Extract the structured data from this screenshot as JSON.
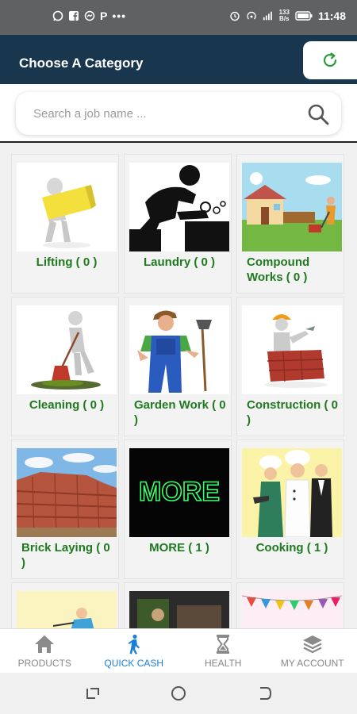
{
  "status_bar": {
    "left_icons": [
      "whatsapp-icon",
      "facebook-icon",
      "messenger-icon",
      "p-icon",
      "more-dots-icon"
    ],
    "p_letter": "P",
    "dots": "•••",
    "network_speed_top": "133",
    "network_speed_bottom": "B/s",
    "time": "11:48"
  },
  "header": {
    "title": "Choose A Category",
    "accent_color": "#18364d"
  },
  "search": {
    "placeholder": "Search a job name ..."
  },
  "categories": [
    {
      "label": "Lifting ( 0 )",
      "icon": "lifting-image"
    },
    {
      "label": "Laundry ( 0 )",
      "icon": "laundry-image"
    },
    {
      "label": "Compound Works ( 0 )",
      "icon": "compound-works-image"
    },
    {
      "label": "Cleaning ( 0 )",
      "icon": "cleaning-image"
    },
    {
      "label": "Garden Work ( 0 )",
      "icon": "garden-work-image"
    },
    {
      "label": "Construction ( 0 )",
      "icon": "construction-image"
    },
    {
      "label": "Brick Laying ( 0 )",
      "icon": "brick-laying-image"
    },
    {
      "label": "MORE ( 1 )",
      "icon": "more-image",
      "image_text": "MORE"
    },
    {
      "label": "Cooking ( 1 )",
      "icon": "cooking-image"
    }
  ],
  "bottom_nav": [
    {
      "label": "PRODUCTS",
      "icon": "home-icon",
      "active": false
    },
    {
      "label": "QUICK CASH",
      "icon": "walking-person-icon",
      "active": true
    },
    {
      "label": "HEALTH",
      "icon": "hourglass-icon",
      "active": false
    },
    {
      "label": "MY ACCOUNT",
      "icon": "layers-icon",
      "active": false
    }
  ],
  "colors": {
    "label_green": "#1e7a1e",
    "active_blue": "#1a7fd8",
    "refresh_green": "#2e9a3e"
  }
}
